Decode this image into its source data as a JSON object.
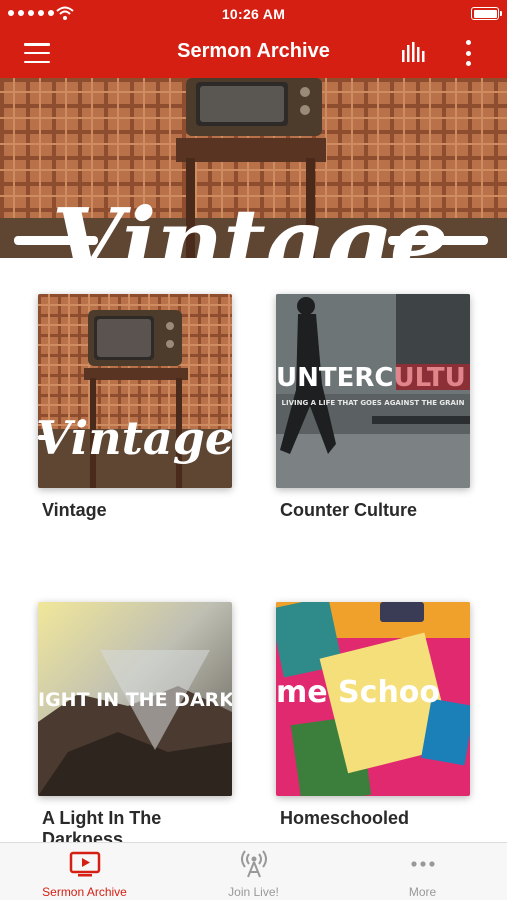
{
  "status_bar": {
    "time": "10:26 AM"
  },
  "header": {
    "title": "Sermon Archive"
  },
  "hero": {
    "text": "Vintage"
  },
  "series": [
    {
      "title": "Vintage",
      "art_text": "Vintage"
    },
    {
      "title": "Counter Culture",
      "art_text": "UNTERCULTU",
      "art_subtext": "LIVING A LIFE THAT GOES AGAINST THE GRAIN"
    },
    {
      "title": "A Light In The Darkness",
      "art_text": "IGHT IN THE DARKNE"
    },
    {
      "title": "Homeschooled",
      "art_text": "me Schoo"
    }
  ],
  "tabs": [
    {
      "label": "Sermon Archive",
      "icon": "tv-play-icon",
      "active": true
    },
    {
      "label": "Join Live!",
      "icon": "broadcast-icon",
      "active": false
    },
    {
      "label": "More",
      "icon": "more-dots-icon",
      "active": false
    }
  ],
  "colors": {
    "brand": "#d51f12",
    "tab_inactive": "#999999"
  }
}
